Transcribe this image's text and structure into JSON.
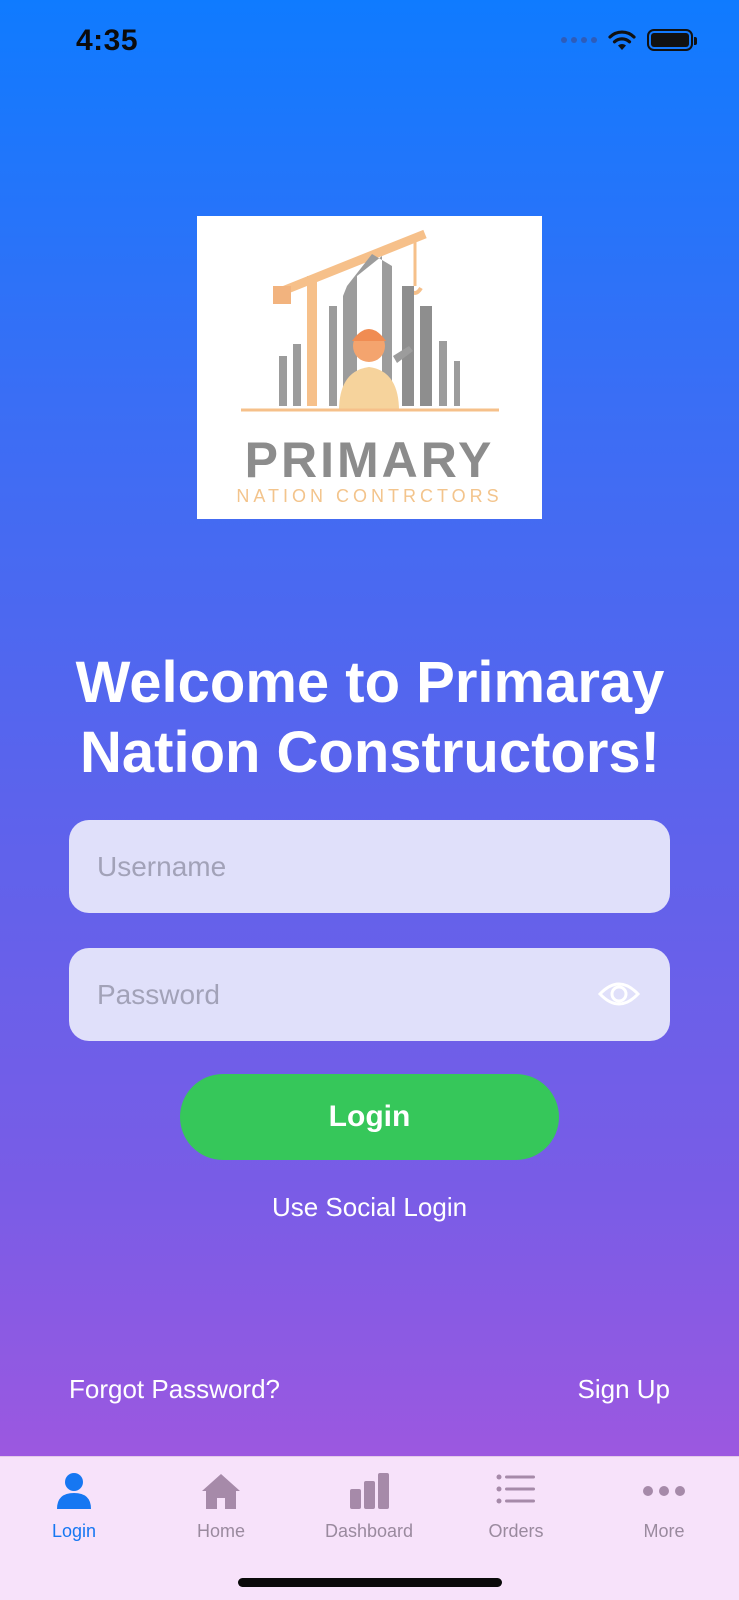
{
  "status": {
    "time": "4:35",
    "icons": [
      "signal-icon",
      "wifi-icon",
      "battery-icon"
    ]
  },
  "logo": {
    "icon": "construction-logo",
    "wordmark": "PRIMARY",
    "tagline": "NATION CONTRCTORS"
  },
  "welcome": {
    "line1": "Welcome to Primaray",
    "line2": "Nation Constructors!"
  },
  "form": {
    "username_placeholder": "Username",
    "username_value": "",
    "password_placeholder": "Password",
    "password_value": "",
    "login_label": "Login",
    "social_label": "Use Social Login"
  },
  "footer": {
    "forgot_label": "Forgot Password?",
    "signup_label": "Sign Up"
  },
  "tabs": [
    {
      "label": "Login",
      "icon": "person-icon",
      "active": true
    },
    {
      "label": "Home",
      "icon": "house-icon",
      "active": false
    },
    {
      "label": "Dashboard",
      "icon": "chart-icon",
      "active": false
    },
    {
      "label": "Orders",
      "icon": "list-icon",
      "active": false
    },
    {
      "label": "More",
      "icon": "ellipsis-icon",
      "active": false
    }
  ],
  "colors": {
    "accent": "#1677f2",
    "login_button": "#36c75a",
    "tab_bar": "#f7e2fa",
    "field_bg": "#e0e0fa"
  }
}
